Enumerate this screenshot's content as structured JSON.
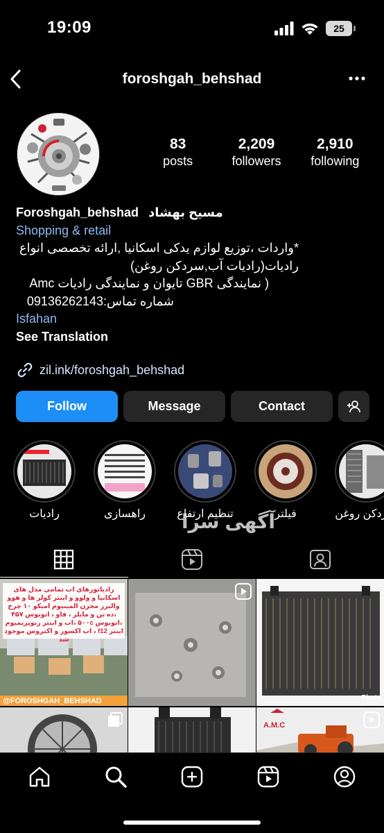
{
  "status_bar": {
    "time": "19:09",
    "battery": "25"
  },
  "header": {
    "username": "foroshgah_behshad"
  },
  "profile": {
    "stats": [
      {
        "value": "83",
        "label": "posts"
      },
      {
        "value": "2,209",
        "label": "followers"
      },
      {
        "value": "2,910",
        "label": "following"
      }
    ],
    "name": "Foroshgah_behshad",
    "name_fa": "مسیح بهشاد",
    "category": "Shopping & retail",
    "bio_lines": [
      "*واردات ،توزیع لوازم یدکی اسکانیا ,ارائه تخصصی انواع",
      "رادیات(رادیات آب,سردکن روغن)",
      "( نمایندگی GBR تایوان و نمایندگی رادیات Amc",
      "شماره تماس:09136262143"
    ],
    "location": "Isfahan",
    "see_translation": "See Translation",
    "link": "zil.ink/foroshgah_behshad"
  },
  "actions": {
    "follow": "Follow",
    "message": "Message",
    "contact": "Contact"
  },
  "highlights": [
    {
      "label": "رادیات"
    },
    {
      "label": "راهسازی"
    },
    {
      "label": "تنظیم ارتفاع"
    },
    {
      "label": "فیلتر"
    },
    {
      "label": "سردکن روغن"
    }
  ],
  "watermark": "آگهی سرا",
  "posts": {
    "first_caption": "رادیاتورهای اب تمامی مدل های اسکانیا و ولوو و اینتر کولر ها و هوو والبرز مخزن المینیوم امیکو ۱۰ چرخ ،ده تن و مایلر ، فاو ، اتوبوس ۴۵۷ ،اتوبوس ۵۰۰c ،اب و اینتر رنوپریمیوم اینتر f12 ، اب اکسور و اکتروس موجود شد",
    "first_tag": "@FOROSHGAH_BEHSHAD",
    "photoroom_tag": "Photo",
    "amc_tag": "A.M.C"
  }
}
